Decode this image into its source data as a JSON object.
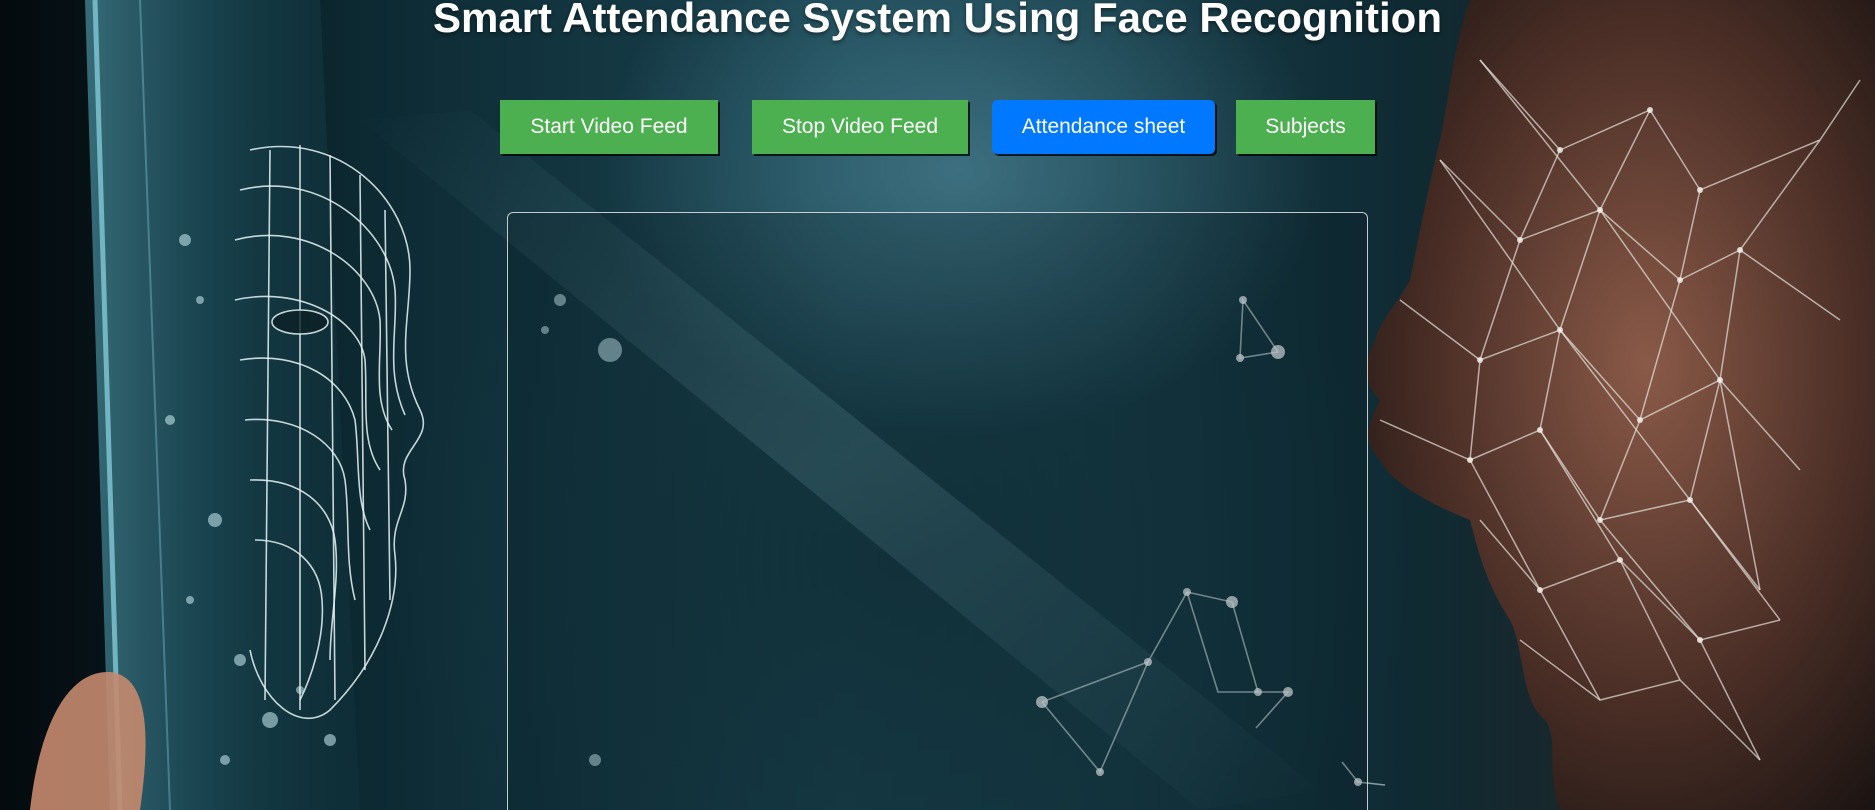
{
  "page": {
    "title": "Smart Attendance System Using Face Recognition"
  },
  "toolbar": {
    "start_label": "Start Video Feed",
    "stop_label": "Stop Video Feed",
    "attendance_label": "Attendance sheet",
    "subjects_label": "Subjects"
  },
  "colors": {
    "green_button": "#4caf50",
    "blue_button": "#0078ff",
    "title_text": "#ffffff"
  },
  "icons": {
    "background": "face-recognition-background-image"
  }
}
